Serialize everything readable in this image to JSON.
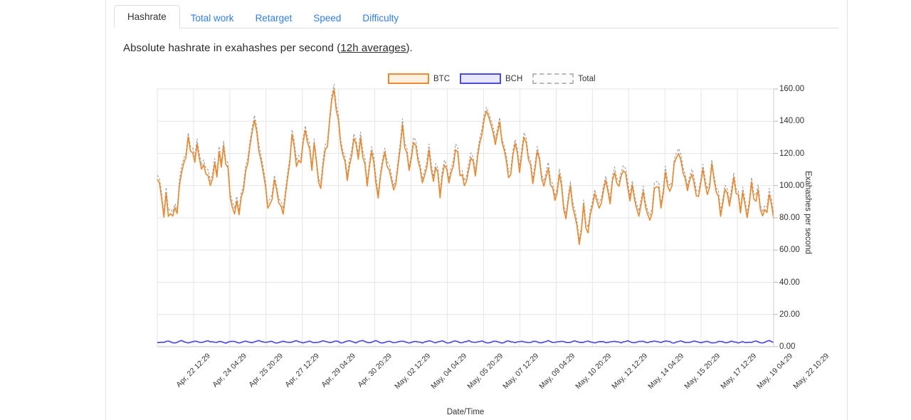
{
  "tabs": [
    {
      "label": "Hashrate",
      "active": true
    },
    {
      "label": "Total work",
      "active": false
    },
    {
      "label": "Retarget",
      "active": false
    },
    {
      "label": "Speed",
      "active": false
    },
    {
      "label": "Difficulty",
      "active": false
    }
  ],
  "subtitle": {
    "prefix": "Absolute hashrate in exahashes per second (",
    "link": "12h averages",
    "suffix": ")."
  },
  "legend": {
    "position": "top-center",
    "items": [
      {
        "label": "BTC",
        "color": "#f0882a",
        "fill": "#fdf1e4",
        "style": "solid"
      },
      {
        "label": "BCH",
        "color": "#4a4ae8",
        "fill": "#e8e8fc",
        "style": "solid"
      },
      {
        "label": "Total",
        "color": "#b9b9b9",
        "fill": "#fcfcfc",
        "style": "dashed"
      }
    ]
  },
  "chart_data": {
    "type": "line",
    "title": "",
    "xlabel": "Date/Time",
    "ylabel": "Exahashes per second",
    "ylim": [
      0,
      160
    ],
    "yticks": [
      "0.00",
      "20.00",
      "40.00",
      "60.00",
      "80.00",
      "100.00",
      "120.00",
      "140.00",
      "160.00"
    ],
    "ytick_values": [
      0,
      20,
      40,
      60,
      80,
      100,
      120,
      140,
      160
    ],
    "grid": true,
    "legend_position": "top-center",
    "xticks": [
      "Apr, 22 12:29",
      "Apr, 24 04:29",
      "Apr, 25 20:29",
      "Apr, 27 12:29",
      "Apr, 29 04:29",
      "Apr, 30 20:29",
      "May, 02 12:29",
      "May, 04 04:29",
      "May, 05 20:29",
      "May, 07 12:29",
      "May, 09 04:29",
      "May, 10 20:29",
      "May, 12 12:29",
      "May, 14 04:29",
      "May, 15 20:29",
      "May, 17 12:29",
      "May, 19 04:29",
      "May, 22 10:29"
    ],
    "xtick_positions": [
      0,
      0.0588,
      0.1176,
      0.1765,
      0.2353,
      0.2941,
      0.3529,
      0.4118,
      0.4706,
      0.5294,
      0.5882,
      0.6471,
      0.7059,
      0.7647,
      0.8235,
      0.8824,
      0.9412,
      1.0
    ],
    "series": [
      {
        "name": "BTC",
        "color": "#f0882a",
        "style": "solid",
        "values": [
          106,
          98,
          88,
          82,
          92,
          80,
          84,
          78,
          90,
          86,
          98,
          108,
          116,
          122,
          128,
          120,
          124,
          118,
          126,
          114,
          108,
          112,
          104,
          110,
          100,
          106,
          112,
          104,
          118,
          112,
          124,
          116,
          108,
          96,
          90,
          84,
          88,
          80,
          90,
          100,
          110,
          118,
          126,
          134,
          140,
          132,
          120,
          112,
          104,
          96,
          90,
          86,
          96,
          106,
          100,
          92,
          86,
          82,
          94,
          104,
          116,
          128,
          122,
          114,
          120,
          112,
          126,
          136,
          130,
          120,
          112,
          122,
          114,
          104,
          96,
          108,
          118,
          128,
          140,
          150,
          158,
          148,
          138,
          128,
          120,
          112,
          104,
          110,
          120,
          130,
          124,
          116,
          126,
          118,
          110,
          104,
          112,
          120,
          112,
          104,
          96,
          104,
          114,
          122,
          116,
          108,
          100,
          94,
          102,
          112,
          124,
          134,
          128,
          120,
          112,
          120,
          128,
          122,
          114,
          106,
          98,
          104,
          112,
          120,
          114,
          106,
          112,
          104,
          96,
          104,
          114,
          106,
          98,
          106,
          116,
          124,
          118,
          110,
          104,
          96,
          104,
          112,
          120,
          114,
          106,
          116,
          126,
          134,
          142,
          150,
          146,
          138,
          130,
          122,
          128,
          136,
          130,
          120,
          112,
          104,
          110,
          118,
          126,
          120,
          112,
          122,
          132,
          126,
          118,
          110,
          104,
          112,
          120,
          112,
          104,
          96,
          104,
          112,
          104,
          96,
          88,
          96,
          104,
          96,
          88,
          80,
          88,
          96,
          88,
          80,
          72,
          68,
          76,
          84,
          78,
          72,
          80,
          88,
          96,
          90,
          84,
          92,
          100,
          106,
          98,
          92,
          100,
          108,
          102,
          96,
          104,
          112,
          106,
          98,
          92,
          100,
          94,
          86,
          80,
          88,
          96,
          90,
          84,
          78,
          86,
          94,
          102,
          96,
          90,
          98,
          106,
          100,
          94,
          102,
          110,
          116,
          122,
          116,
          108,
          100,
          94,
          102,
          110,
          104,
          96,
          90,
          98,
          106,
          100,
          94,
          102,
          110,
          104,
          96,
          90,
          84,
          92,
          100,
          94,
          88,
          96,
          104,
          98,
          92,
          86,
          94,
          88,
          82,
          90,
          98,
          92,
          86,
          94,
          88,
          80,
          88,
          82,
          90,
          84,
          78
        ]
      },
      {
        "name": "Total",
        "color": "#b9b9b9",
        "style": "dashed",
        "note": "BTC + BCH combined, plotted just above the BTC line"
      },
      {
        "name": "BCH",
        "color": "#4a4ae8",
        "style": "solid",
        "values": [
          2.4,
          2.6,
          2.8,
          2.5,
          3.0,
          3.4,
          3.0,
          2.6,
          2.4,
          2.8,
          3.2,
          3.6,
          3.2,
          2.8,
          2.5,
          2.8,
          3.2,
          3.5,
          3.1,
          2.7,
          2.5,
          2.9,
          3.3,
          3.6,
          3.2,
          2.8,
          2.5,
          2.9,
          3.3,
          3.0,
          2.6,
          2.4,
          2.8,
          3.2,
          3.5,
          3.1,
          2.7,
          2.4,
          2.8,
          3.2,
          3.4,
          3.0,
          2.6,
          2.4,
          2.8,
          3.3,
          3.6,
          3.2,
          2.8,
          2.5,
          2.9,
          3.3,
          3.0,
          2.6,
          2.4,
          2.8,
          3.2,
          3.5,
          3.1,
          2.7,
          2.5,
          2.9,
          3.3,
          3.5,
          3.0,
          2.6,
          2.4,
          2.8,
          3.2,
          3.4,
          3.0,
          2.7,
          2.5,
          2.9,
          3.3,
          3.6,
          3.1,
          2.7,
          2.5,
          2.9,
          3.2,
          3.5,
          3.0,
          2.6,
          2.4,
          2.8,
          3.3,
          3.6,
          3.2,
          2.8,
          2.6,
          3.0,
          3.4,
          3.7,
          3.2,
          2.8,
          2.5,
          2.9,
          3.3,
          3.6,
          3.1,
          2.7,
          2.5,
          2.9,
          3.2,
          3.4,
          3.0,
          2.6,
          2.4,
          2.8,
          3.2,
          3.5,
          3.1,
          2.7,
          2.4,
          2.8,
          3.2,
          3.5,
          3.0,
          2.6,
          2.4,
          2.8,
          3.3,
          3.6,
          3.2,
          2.8,
          2.5,
          2.9,
          3.3,
          3.5,
          3.0,
          2.6,
          2.4,
          2.8,
          3.2,
          3.4,
          3.0,
          2.7,
          2.5,
          2.9,
          3.3,
          3.6,
          3.1,
          2.7,
          2.5,
          2.9,
          3.2,
          3.5,
          3.0,
          2.6,
          2.4,
          2.8,
          3.2,
          3.5,
          3.1,
          2.7,
          2.4,
          2.8,
          3.3,
          3.6,
          3.2,
          2.8,
          2.5,
          2.9,
          3.3,
          3.5,
          3.0,
          2.6,
          2.4,
          2.8,
          3.2,
          3.4,
          3.0,
          2.7,
          2.5,
          2.9,
          3.3,
          3.6,
          3.1,
          2.7,
          2.5,
          2.9,
          3.2,
          3.5,
          3.0,
          2.6,
          2.4,
          2.8,
          3.3,
          3.6,
          3.2,
          2.8,
          2.5,
          2.9,
          3.3,
          3.5,
          3.0,
          2.6,
          2.4,
          2.8,
          3.2,
          3.4,
          3.0,
          2.7,
          2.5,
          2.9,
          3.3,
          3.6,
          3.1,
          2.7,
          2.5,
          2.9,
          3.2,
          3.5,
          3.0,
          2.6,
          2.4,
          2.8,
          3.2,
          3.5,
          3.1,
          2.7,
          2.4,
          2.8,
          3.3,
          3.6,
          3.2,
          2.8,
          2.5,
          2.9,
          3.3,
          3.5,
          3.0,
          2.6,
          2.4,
          2.8,
          3.2,
          3.4,
          3.0,
          2.7,
          2.5,
          2.9,
          3.3,
          3.6,
          3.1,
          2.7,
          2.5,
          2.9,
          3.2,
          3.5,
          3.0,
          2.6,
          2.4,
          2.8,
          3.2,
          3.5,
          3.1,
          2.7,
          2.5,
          2.9,
          3.3,
          3.0,
          2.7,
          2.5,
          2.9,
          3.3
        ]
      }
    ]
  }
}
